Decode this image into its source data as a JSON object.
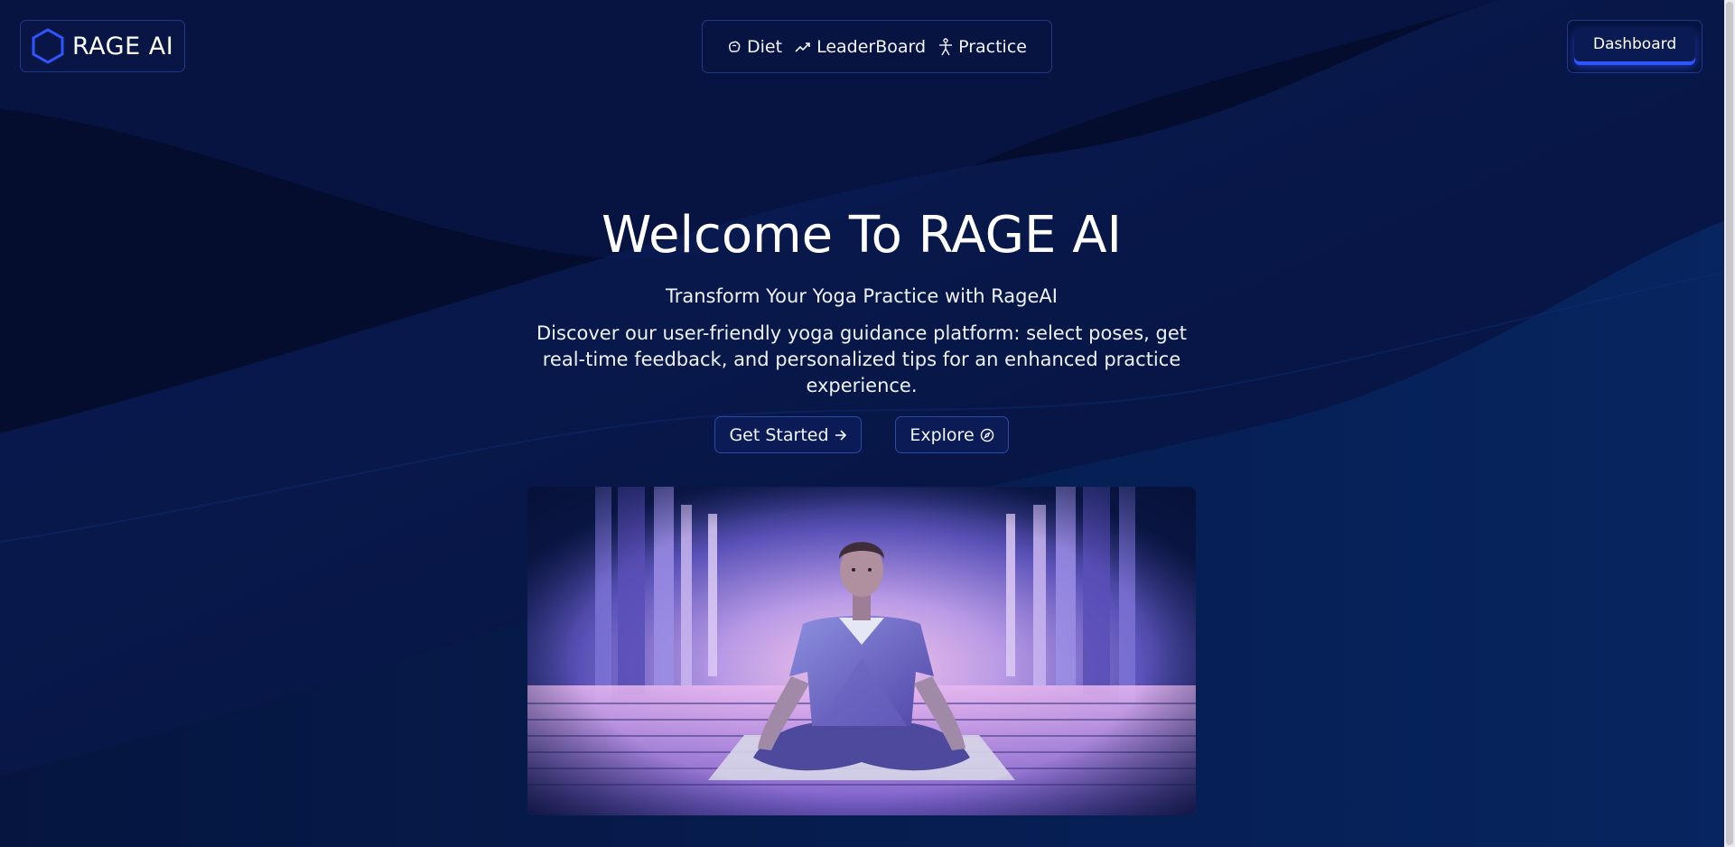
{
  "brand": {
    "name": "RAGE AI",
    "logo_icon": "hexagon-icon",
    "accent": "#2e55ff"
  },
  "nav": {
    "items": [
      {
        "label": "Diet",
        "icon": "brain-icon"
      },
      {
        "label": "LeaderBoard",
        "icon": "trending-up-icon"
      },
      {
        "label": "Practice",
        "icon": "person-pose-icon"
      }
    ]
  },
  "header": {
    "dashboard_label": "Dashboard"
  },
  "hero": {
    "title": "Welcome To RAGE AI",
    "subtitle": "Transform Your Yoga Practice with RageAI",
    "description": "Discover our user-friendly yoga guidance platform: select poses, get real-time feedback, and personalized tips for an enhanced practice experience.",
    "buttons": {
      "get_started": "Get Started",
      "get_started_icon": "arrow-right-icon",
      "explore": "Explore",
      "explore_icon": "compass-icon"
    },
    "illustration": "meditating-man-illustration"
  },
  "colors": {
    "background": "#04102f",
    "border": "#1f3a85"
  }
}
